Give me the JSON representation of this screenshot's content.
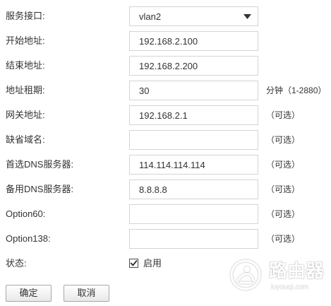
{
  "form": {
    "service_interface": {
      "label": "服务接口:",
      "value": "vlan2"
    },
    "start_address": {
      "label": "开始地址:",
      "value": "192.168.2.100"
    },
    "end_address": {
      "label": "结束地址:",
      "value": "192.168.2.200"
    },
    "lease_time": {
      "label": "地址租期:",
      "value": "30",
      "suffix": "分钟（1-2880）"
    },
    "gateway": {
      "label": "网关地址:",
      "value": "192.168.2.1",
      "suffix": "（可选）"
    },
    "default_domain": {
      "label": "缺省域名:",
      "value": "",
      "suffix": "（可选）"
    },
    "primary_dns": {
      "label": "首选DNS服务器:",
      "value": "114.114.114.114",
      "suffix": "（可选）"
    },
    "secondary_dns": {
      "label": "备用DNS服务器:",
      "value": "8.8.8.8",
      "suffix": "（可选）"
    },
    "option60": {
      "label": "Option60:",
      "value": "",
      "suffix": "（可选）"
    },
    "option138": {
      "label": "Option138:",
      "value": "",
      "suffix": "（可选）"
    },
    "status": {
      "label": "状态:",
      "checkbox_label": "启用",
      "checked": true
    }
  },
  "buttons": {
    "confirm": "确定",
    "cancel": "取消"
  },
  "watermark": {
    "brand": "路由器",
    "domain": "luyouqi.com"
  },
  "icons": {
    "dropdown": "dropdown-triangle-icon",
    "checkbox": "check-icon",
    "watermark": "router-logo-icon"
  },
  "colors": {
    "text": "#333333",
    "field_border": "#d4d4d4",
    "button_border": "#a8a8a8",
    "background": "#ffffff"
  }
}
